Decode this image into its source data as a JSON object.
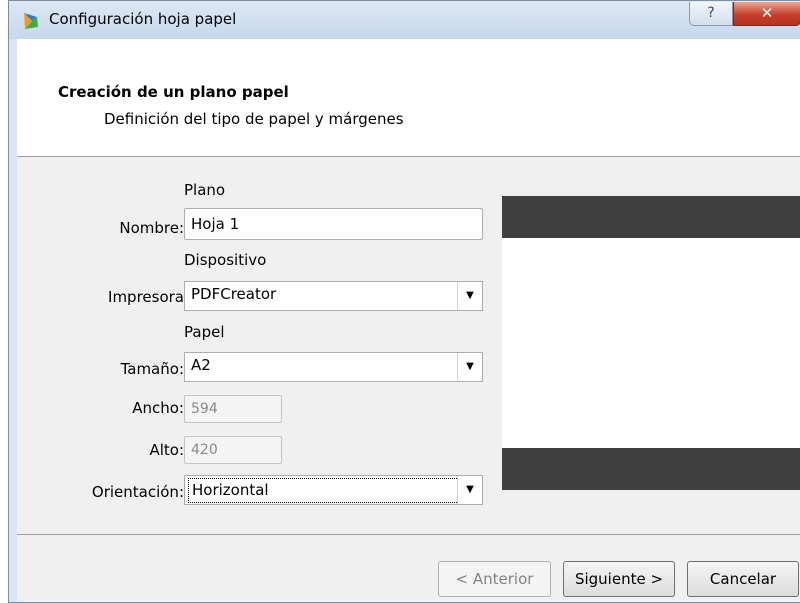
{
  "window": {
    "title": "Configuración hoja papel",
    "help_glyph": "?",
    "close_glyph": "✕"
  },
  "header": {
    "title": "Creación de un plano papel",
    "subtitle": "Definición del tipo de papel y márgenes"
  },
  "form": {
    "section_plano": "Plano",
    "nombre_label": "Nombre:",
    "nombre_value": "Hoja 1",
    "section_dispositivo": "Dispositivo",
    "impresora_label": "Impresora",
    "impresora_value": "PDFCreator",
    "section_papel": "Papel",
    "tamano_label": "Tamaño:",
    "tamano_value": "A2",
    "ancho_label": "Ancho:",
    "ancho_value": "594",
    "alto_label": "Alto:",
    "alto_value": "420",
    "orientacion_label": "Orientación:",
    "orientacion_value": "Horizontal"
  },
  "buttons": {
    "anterior": "< Anterior",
    "siguiente": "Siguiente >",
    "cancelar": "Cancelar"
  },
  "icons": {
    "app": "app-logo-icon",
    "dropdown": "chevron-down-icon"
  },
  "colors": {
    "preview_band": "#3f3f3f",
    "close_button": "#c6402c"
  }
}
